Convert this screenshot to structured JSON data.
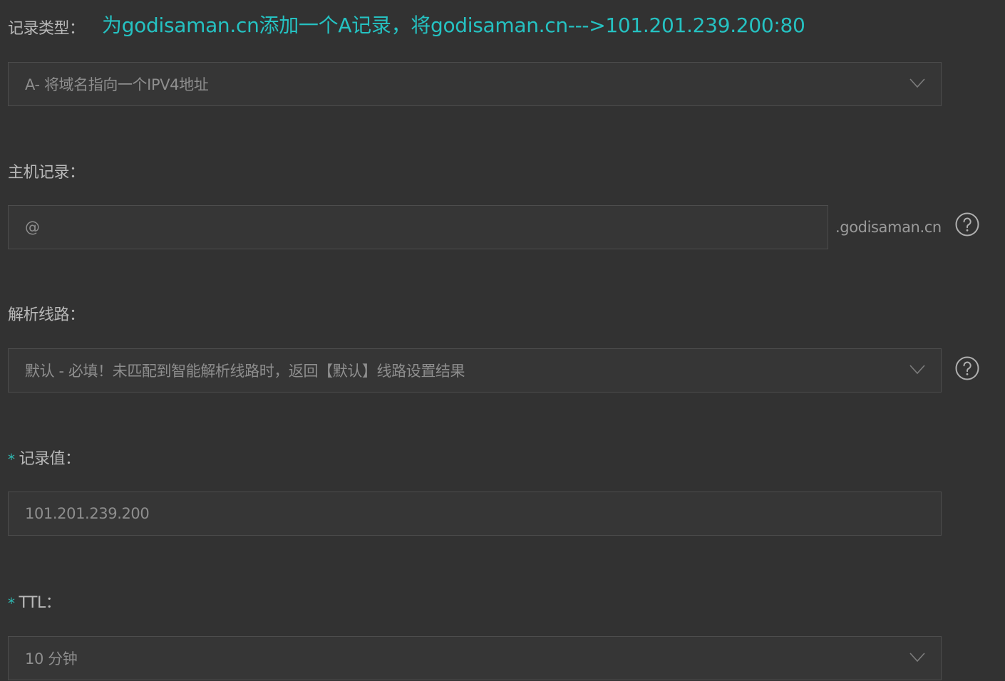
{
  "record_type": {
    "label": "记录类型：",
    "annotation": "为godisaman.cn添加一个A记录，将godisaman.cn--->101.201.239.200:80",
    "value": "A- 将域名指向一个IPV4地址"
  },
  "host_record": {
    "label": "主机记录：",
    "value": "@",
    "suffix": ".godisaman.cn"
  },
  "resolve_line": {
    "label": "解析线路：",
    "value": "默认 - 必填！未匹配到智能解析线路时，返回【默认】线路设置结果"
  },
  "record_value": {
    "required_mark": "*",
    "label": "记录值：",
    "value": "101.201.239.200"
  },
  "ttl": {
    "required_mark": "*",
    "label": "TTL：",
    "value": "10 分钟"
  },
  "icons": {
    "dropdown": "chevron-down-icon",
    "help": "question-circle-icon"
  },
  "colors": {
    "background": "#323232",
    "annotation": "#25c2c2",
    "required": "#2fb7b0",
    "field_border": "#4d4d4d"
  }
}
